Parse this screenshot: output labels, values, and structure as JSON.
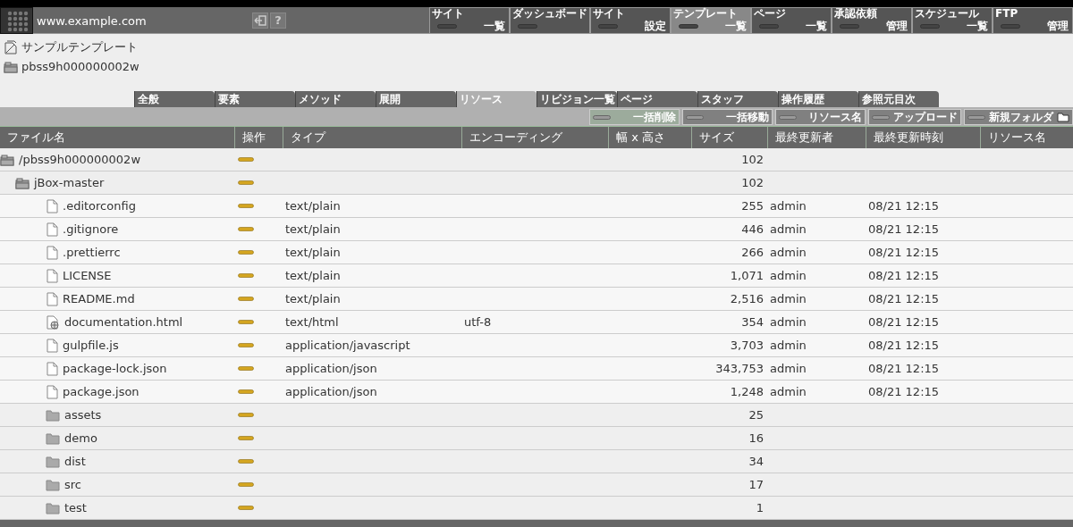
{
  "header": {
    "site": "www.example.com",
    "help": "?"
  },
  "nav": [
    {
      "top": "サイト",
      "bottom": "一覧",
      "selected": false
    },
    {
      "top": "ダッシュボード",
      "selected": false
    },
    {
      "top": "サイト",
      "bottom": "設定",
      "selected": false
    },
    {
      "top": "テンプレート",
      "bottom": "一覧",
      "selected": true
    },
    {
      "top": "ページ",
      "bottom": "一覧",
      "selected": false
    },
    {
      "top": "承認依頼",
      "bottom": "管理",
      "selected": false
    },
    {
      "top": "スケジュール",
      "bottom": "一覧",
      "selected": false
    },
    {
      "top": "FTP",
      "bottom": "管理",
      "selected": false
    }
  ],
  "breadcrumbs": [
    {
      "kind": "template",
      "label": "サンプルテンプレート"
    },
    {
      "kind": "stack",
      "label": "pbss9h000000002w"
    }
  ],
  "tabs": [
    {
      "label": "全般",
      "selected": false
    },
    {
      "label": "要素",
      "selected": false
    },
    {
      "label": "メソッド",
      "selected": false
    },
    {
      "label": "展開",
      "selected": false
    },
    {
      "label": "リソース",
      "selected": true
    },
    {
      "label": "リビジョン一覧",
      "selected": false
    },
    {
      "label": "ページ",
      "selected": false
    },
    {
      "label": "スタッフ",
      "selected": false
    },
    {
      "label": "操作履歴",
      "selected": false
    },
    {
      "label": "参照元目次",
      "selected": false
    }
  ],
  "toolbar": [
    {
      "label": "一括削除",
      "kind": "button",
      "selected": true
    },
    {
      "label": "一括移動",
      "kind": "button",
      "selected": false
    },
    {
      "label": "リソース名",
      "kind": "button",
      "selected": false
    },
    {
      "label": "アップロード",
      "kind": "button",
      "selected": false
    },
    {
      "label": "新規フォルダ",
      "kind": "folder-button",
      "selected": false
    }
  ],
  "table": {
    "columns": [
      "ファイル名",
      "操作",
      "タイプ",
      "エンコーディング",
      "幅 x 高さ",
      "サイズ",
      "最終更新者",
      "最終更新時刻",
      "リソース名"
    ],
    "rows": [
      {
        "kind": "folder-stack",
        "name": "/pbss9h000000002w",
        "size": "102",
        "children": [
          {
            "kind": "folder-stack",
            "name": "jBox-master",
            "size": "102",
            "children": [
              {
                "kind": "file",
                "name": ".editorconfig",
                "type": "text/plain",
                "size": "255",
                "user": "admin",
                "time": "08/21 12:15"
              },
              {
                "kind": "file",
                "name": ".gitignore",
                "type": "text/plain",
                "size": "446",
                "user": "admin",
                "time": "08/21 12:15"
              },
              {
                "kind": "file",
                "name": ".prettierrc",
                "type": "text/plain",
                "size": "266",
                "user": "admin",
                "time": "08/21 12:15"
              },
              {
                "kind": "file",
                "name": "LICENSE",
                "type": "text/plain",
                "size": "1,071",
                "user": "admin",
                "time": "08/21 12:15"
              },
              {
                "kind": "file",
                "name": "README.md",
                "type": "text/plain",
                "size": "2,516",
                "user": "admin",
                "time": "08/21 12:15"
              },
              {
                "kind": "web-file",
                "name": "documentation.html",
                "type": "text/html",
                "encoding": "utf-8",
                "size": "354",
                "user": "admin",
                "time": "08/21 12:15"
              },
              {
                "kind": "file",
                "name": "gulpfile.js",
                "type": "application/javascript",
                "size": "3,703",
                "user": "admin",
                "time": "08/21 12:15"
              },
              {
                "kind": "file",
                "name": "package-lock.json",
                "type": "application/json",
                "size": "343,753",
                "user": "admin",
                "time": "08/21 12:15"
              },
              {
                "kind": "file",
                "name": "package.json",
                "type": "application/json",
                "size": "1,248",
                "user": "admin",
                "time": "08/21 12:15"
              },
              {
                "kind": "folder",
                "name": "assets",
                "size": "25"
              },
              {
                "kind": "folder",
                "name": "demo",
                "size": "16"
              },
              {
                "kind": "folder",
                "name": "dist",
                "size": "34"
              },
              {
                "kind": "folder",
                "name": "src",
                "size": "17"
              },
              {
                "kind": "folder",
                "name": "test",
                "size": "1"
              }
            ]
          }
        ]
      }
    ]
  }
}
